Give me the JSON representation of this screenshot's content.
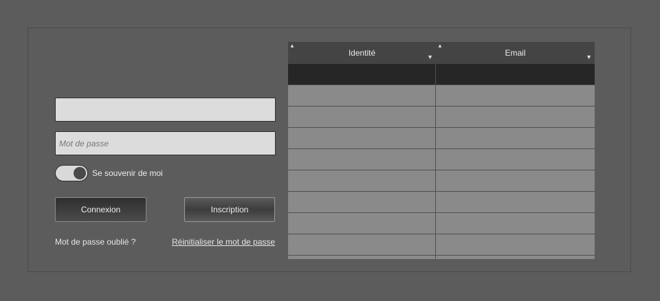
{
  "form": {
    "username_value": "",
    "password_placeholder": "Mot de passe",
    "remember_label": "Se souvenir de moi",
    "remember_checked": true,
    "login_label": "Connexion",
    "signup_label": "Inscription",
    "forgot_label": "Mot de passe oublié ?",
    "reset_label": "Réinitialiser le mot de passe"
  },
  "grid": {
    "columns": [
      "Identité",
      "Email"
    ],
    "rows": [
      [
        "",
        ""
      ],
      [
        "",
        ""
      ],
      [
        "",
        ""
      ],
      [
        "",
        ""
      ],
      [
        "",
        ""
      ],
      [
        "",
        ""
      ],
      [
        "",
        ""
      ],
      [
        "",
        ""
      ],
      [
        "",
        ""
      ],
      [
        "",
        ""
      ]
    ],
    "selected_row": 0
  },
  "icons": {
    "sort": "sort-arrows-icon",
    "filter": "filter-icon",
    "toggle": "toggle-switch-icon"
  }
}
